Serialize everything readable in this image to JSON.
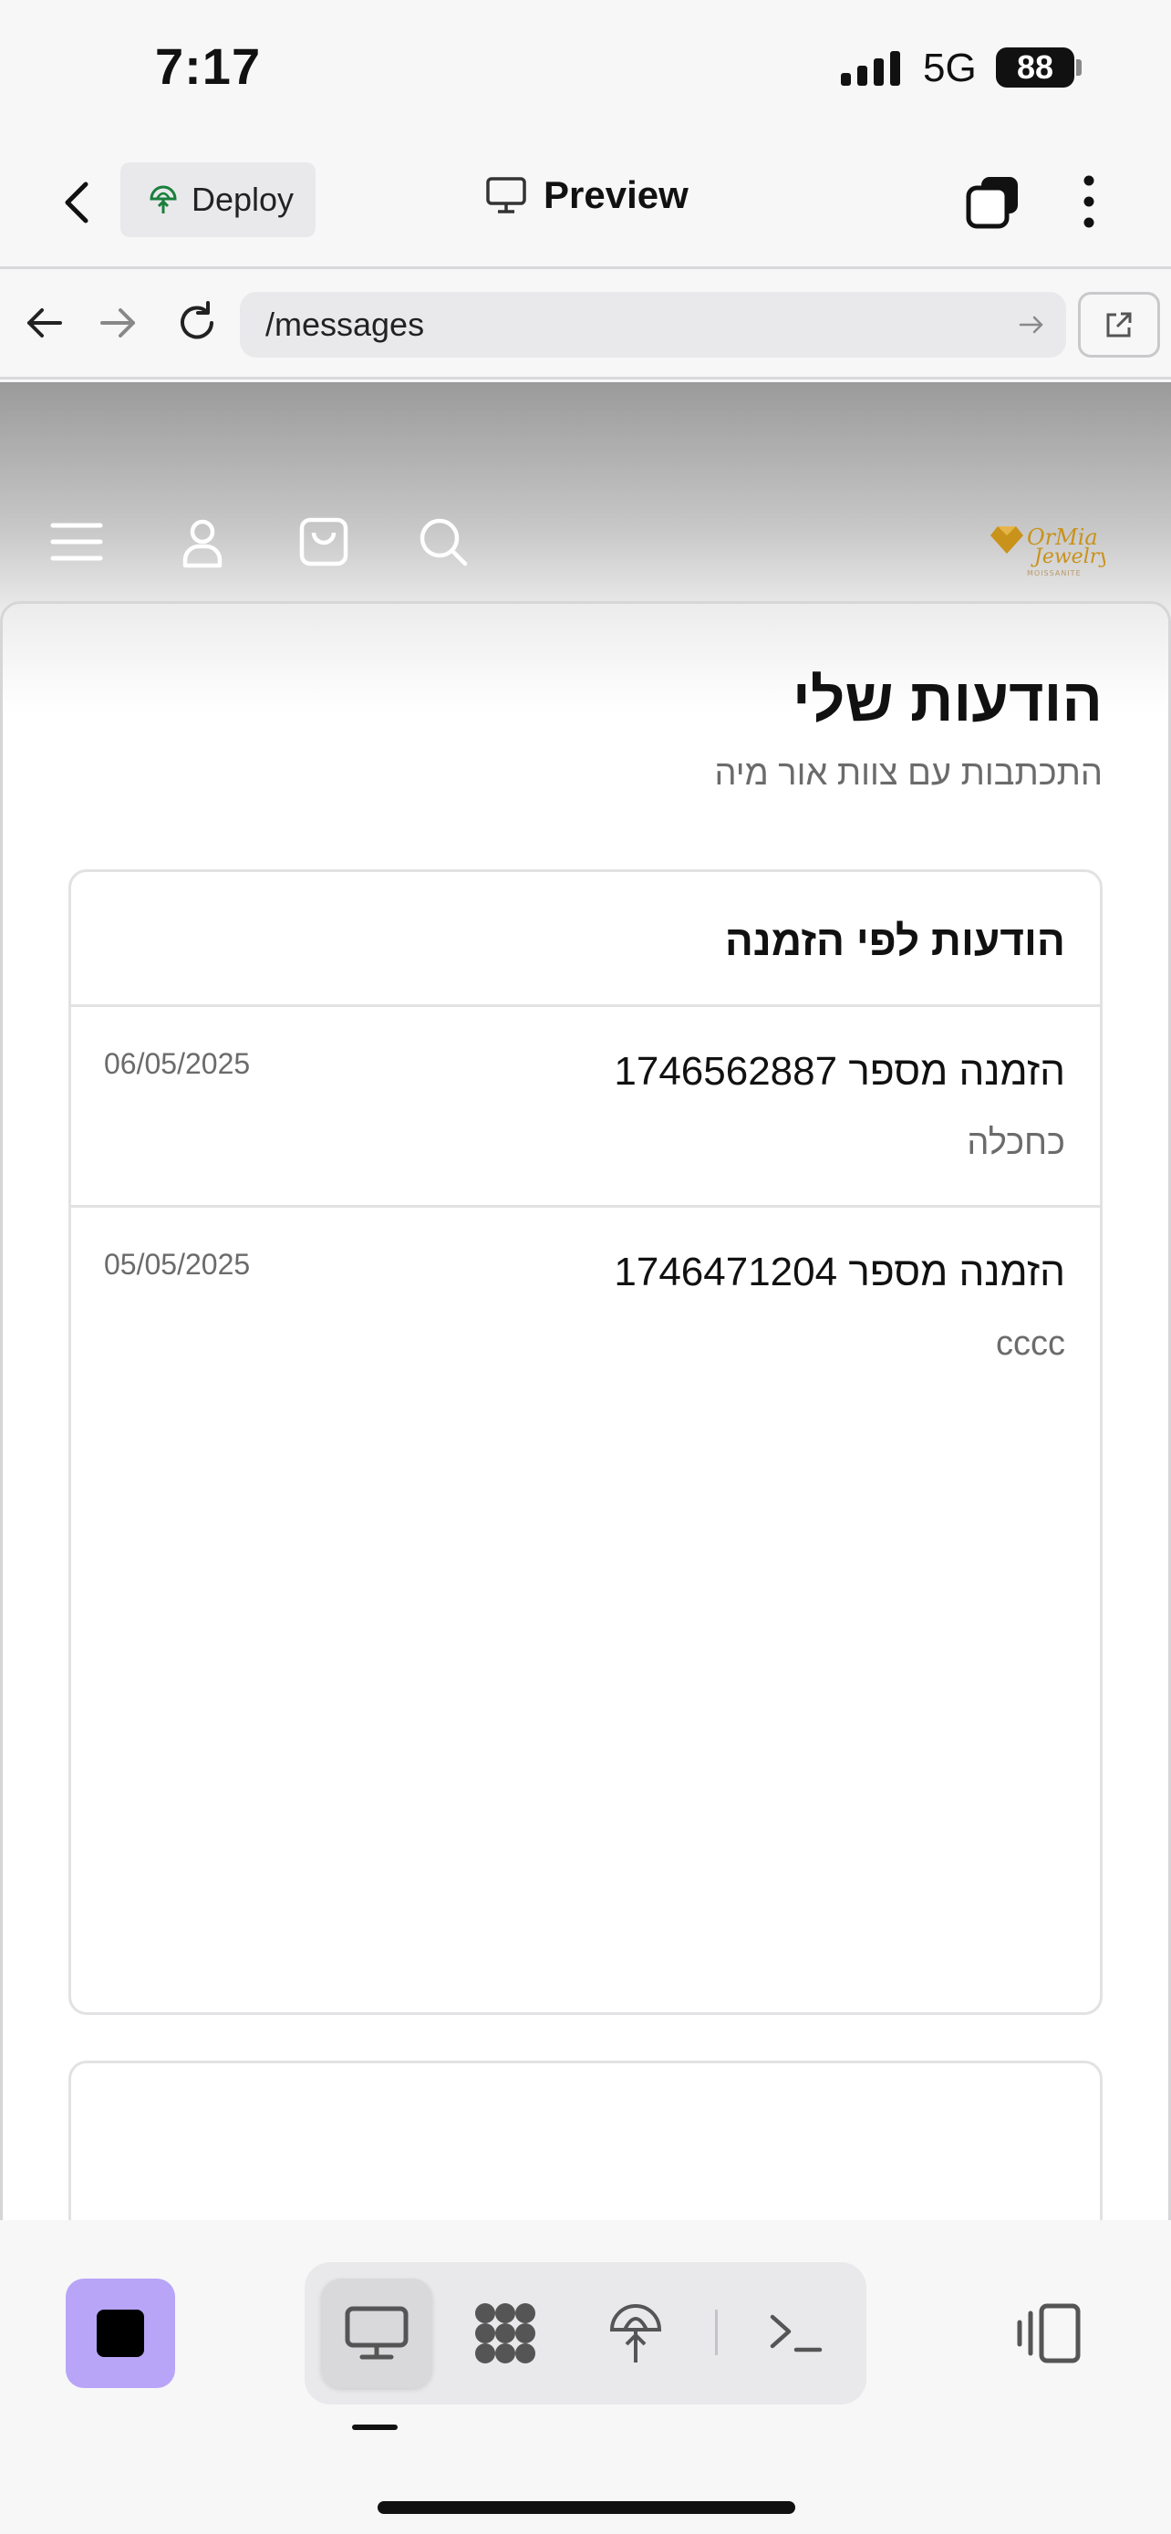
{
  "status_bar": {
    "time": "7:17",
    "network": "5G",
    "battery": "88"
  },
  "app_header": {
    "deploy_label": "Deploy",
    "preview_label": "Preview"
  },
  "url_bar": {
    "url": "/messages"
  },
  "site": {
    "logo_text_main": "OrMia",
    "logo_text_sub": "Jewelry",
    "logo_tagline": "MOISSANITE"
  },
  "page": {
    "title": "הודעות שלי",
    "subtitle": "התכתבות עם צוות אור מיה"
  },
  "messages_card": {
    "title": "הודעות לפי הזמנה",
    "messages": [
      {
        "title": "הזמנה מספר 1746562887",
        "preview": "כחכלה",
        "date": "06/05/2025"
      },
      {
        "title": "הזמנה מספר 1746471204",
        "preview": "cccc",
        "date": "05/05/2025"
      }
    ]
  },
  "colors": {
    "accent_stop": "#b8a5f7",
    "deploy_icon": "#1a7f3c",
    "logo_gold": "#c9921a"
  },
  "icons": [
    "back-icon",
    "deploy-icon",
    "monitor-icon",
    "tabs-icon",
    "more-icon",
    "arrow-left-icon",
    "arrow-right-icon",
    "reload-icon",
    "go-icon",
    "external-link-icon",
    "menu-icon",
    "user-icon",
    "bag-icon",
    "search-icon",
    "stop-icon",
    "desktop-icon",
    "apps-icon",
    "deploy-icon",
    "terminal-icon",
    "side-panel-icon"
  ]
}
